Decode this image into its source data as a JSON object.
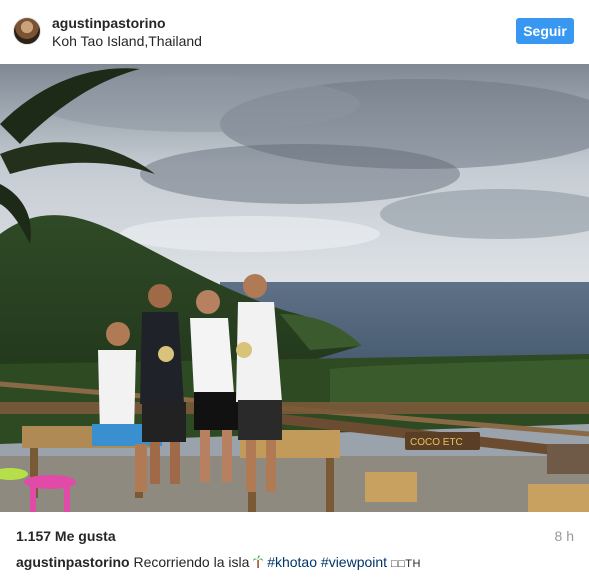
{
  "post": {
    "username": "agustinpastorino",
    "location": "Koh Tao Island,Thailand",
    "follow_label": "Seguir",
    "likes": "1.157 Me gusta",
    "time_ago": "8 h",
    "caption": {
      "user": "agustinpastorino",
      "text": "Recorriendo la isla",
      "emoji": "palm-tree-icon",
      "hashtags": [
        "#khotao",
        "#viewpoint"
      ],
      "suffix": "□□TH"
    },
    "photo_sign": "COCO ETC"
  },
  "colors": {
    "accent": "#3897f0",
    "hashtag": "#003569",
    "muted": "#999999"
  }
}
